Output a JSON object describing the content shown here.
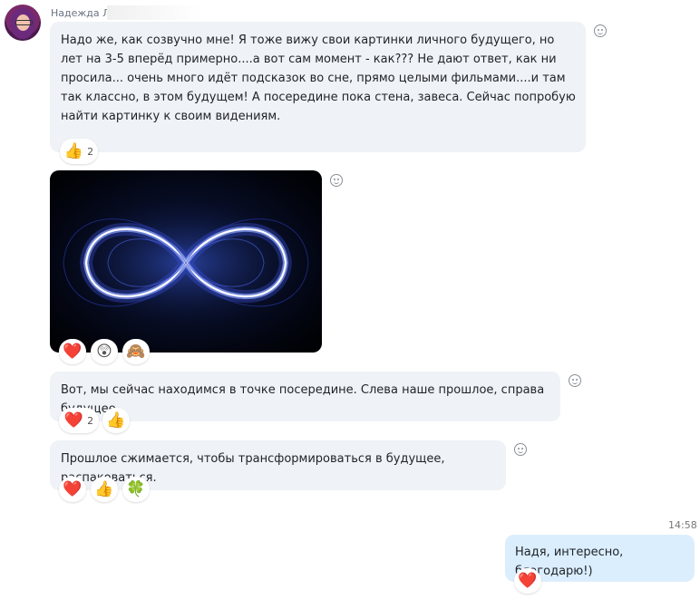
{
  "sender": {
    "name": "Надежда Л"
  },
  "messages": [
    {
      "text": "Надо же, как созвучно мне! Я тоже вижу свои картинки личного будущего, но лет на 3-5 вперёд примерно....а вот сам момент - как??? Не дают ответ, как ни просила... очень много идёт подсказок во сне, прямо целыми фильмами....и там так классно, в этом будущем! А посередине пока стена, завеса. Сейчас попробую найти картинку к своим видениям.",
      "reactions": [
        {
          "icon": "👍",
          "icon_name": "thumbs-up",
          "count": "2"
        }
      ]
    },
    {
      "image": "infinity-light-image",
      "reactions": [
        {
          "icon": "❤️",
          "icon_name": "heart"
        },
        {
          "icon": "😲",
          "icon_name": "surprised"
        },
        {
          "icon": "🙈",
          "icon_name": "monkey"
        }
      ]
    },
    {
      "text": "Вот, мы сейчас находимся в точке посередине. Слева наше прошлое, справа будущее",
      "reactions": [
        {
          "icon": "❤️",
          "icon_name": "heart",
          "count": "2"
        },
        {
          "icon": "👍",
          "icon_name": "thumbs-up"
        }
      ]
    },
    {
      "text": "Прошлое сжимается, чтобы трансформироваться в будущее, распаковаться.",
      "reactions": [
        {
          "icon": "❤️",
          "icon_name": "heart"
        },
        {
          "icon": "👍",
          "icon_name": "thumbs-up"
        },
        {
          "icon": "🍀",
          "icon_name": "clover"
        }
      ]
    }
  ],
  "outgoing": {
    "time": "14:58",
    "text": "Надя, интересно, благодарю!)",
    "reactions": [
      {
        "icon": "❤️",
        "icon_name": "heart"
      }
    ]
  },
  "colors": {
    "incoming_bubble": "#eff2f6",
    "outgoing_bubble": "#dbeefd"
  }
}
